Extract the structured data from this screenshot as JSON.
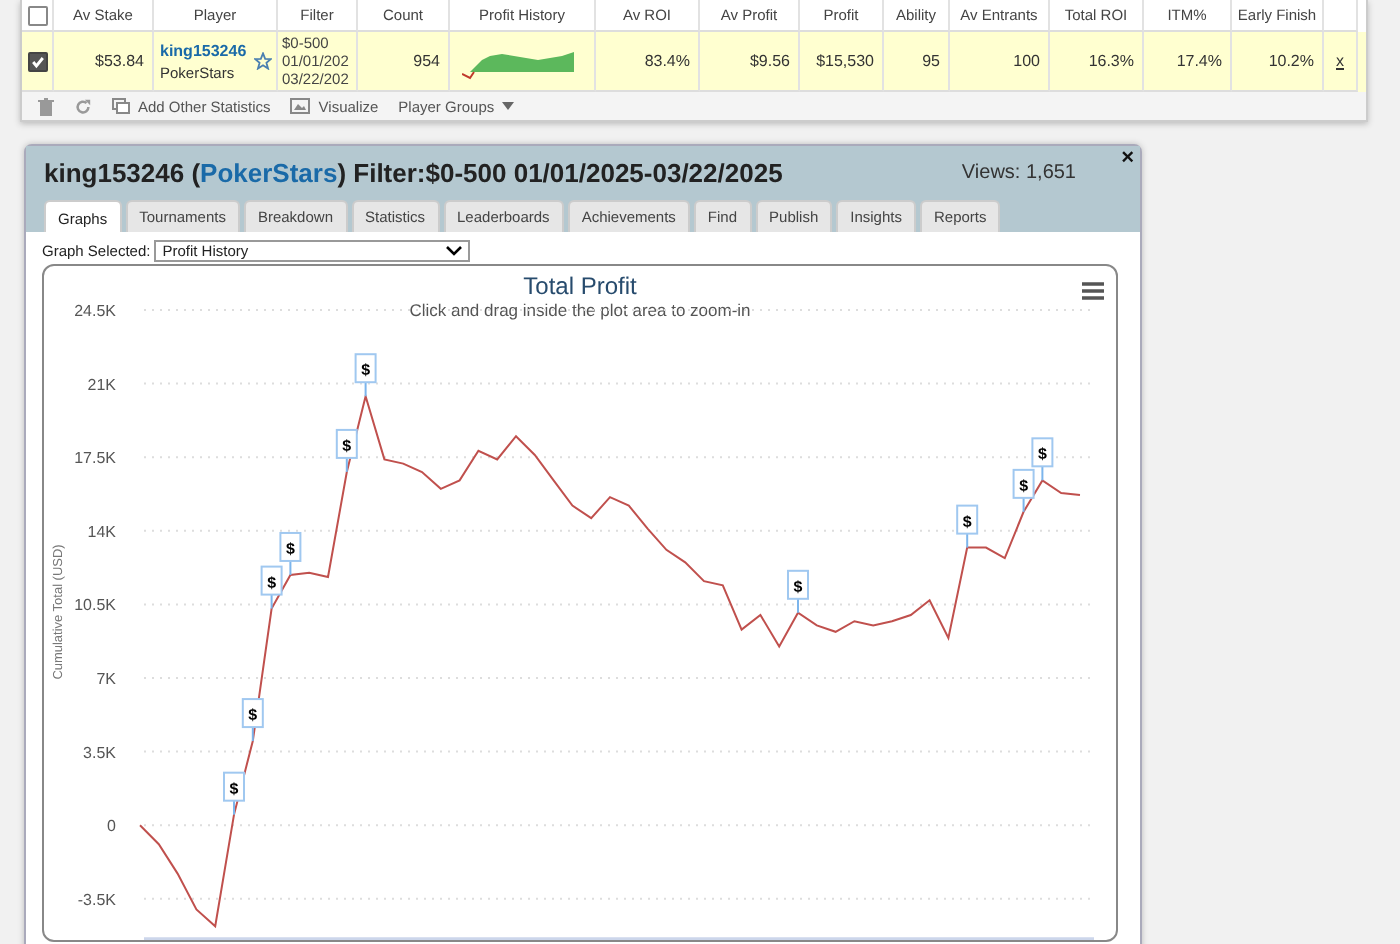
{
  "stats_table": {
    "select_all_checked": false,
    "columns": [
      "Av Stake",
      "Player",
      "Filter",
      "Count",
      "Profit History",
      "Av ROI",
      "Av Profit",
      "Profit",
      "Ability",
      "Av Entrants",
      "Total ROI",
      "ITM%",
      "Early Finish"
    ],
    "rows": [
      {
        "selected": true,
        "av_stake": "$53.84",
        "player": "king153246",
        "site": "PokerStars",
        "filter": [
          "$0-500",
          "01/01/202",
          "03/22/202"
        ],
        "count": "954",
        "av_roi": "83.4%",
        "av_profit": "$9.56",
        "profit": "$15,530",
        "ability": "95",
        "av_entrants": "100",
        "total_roi": "16.3%",
        "itm": "17.4%",
        "early_finish": "10.2%",
        "remove": "x"
      }
    ],
    "toolbar": [
      "Add Other Statistics",
      "Visualize",
      "Player Groups"
    ]
  },
  "panel": {
    "title_before": "king153246 (",
    "site": "PokerStars",
    "title_after": ") Filter:$0-500 01/01/2025-03/22/2025",
    "views": "Views: 1,651",
    "close": "×",
    "tabs": [
      {
        "label": "Graphs",
        "selected": true
      },
      {
        "label": "Tournaments",
        "selected": false
      },
      {
        "label": "Breakdown",
        "selected": false
      },
      {
        "label": "Statistics",
        "selected": false
      },
      {
        "label": "Leaderboards",
        "selected": false
      },
      {
        "label": "Achievements",
        "selected": false
      },
      {
        "label": "Find",
        "selected": false
      },
      {
        "label": "Publish",
        "selected": false
      },
      {
        "label": "Insights",
        "selected": false
      },
      {
        "label": "Reports",
        "selected": false
      }
    ],
    "graph_label": "Graph Selected:",
    "graph_selected": "Profit History",
    "chart": {
      "subtitle": "Click and drag inside the plot area to zoom-in",
      "chart_data": {
        "type": "line",
        "title": "Total Profit",
        "ylabel": "Cumulative Total (USD)",
        "ylim": [
          -5500,
          24500
        ],
        "grid": true,
        "yticks": [
          {
            "value": -3500,
            "label": "-3.5K"
          },
          {
            "value": 0,
            "label": "0"
          },
          {
            "value": 3500,
            "label": "3.5K"
          },
          {
            "value": 7000,
            "label": "7K"
          },
          {
            "value": 10500,
            "label": "10.5K"
          },
          {
            "value": 14000,
            "label": "14K"
          },
          {
            "value": 17500,
            "label": "17.5K"
          },
          {
            "value": 21000,
            "label": "21K"
          },
          {
            "value": 24500,
            "label": "24.5K"
          }
        ],
        "series": [
          {
            "color": "#c0504d",
            "values": [
              0,
              -900,
              -2300,
              -4000,
              -4800,
              500,
              4000,
              10300,
              11900,
              12000,
              11800,
              16800,
              20400,
              17400,
              17200,
              16800,
              16000,
              16400,
              17800,
              17400,
              18500,
              17600,
              16400,
              15200,
              14600,
              15600,
              15200,
              14100,
              13100,
              12500,
              11600,
              11400,
              9300,
              10000,
              8500,
              10100,
              9500,
              9200,
              9700,
              9500,
              9700,
              10000,
              10700,
              8900,
              13200,
              13200,
              12700,
              14900,
              16400,
              15800,
              15700
            ]
          }
        ],
        "annotations": [
          "$",
          "$",
          "$",
          "$",
          "$",
          "$",
          "$",
          "$",
          "$",
          "$"
        ]
      }
    }
  }
}
